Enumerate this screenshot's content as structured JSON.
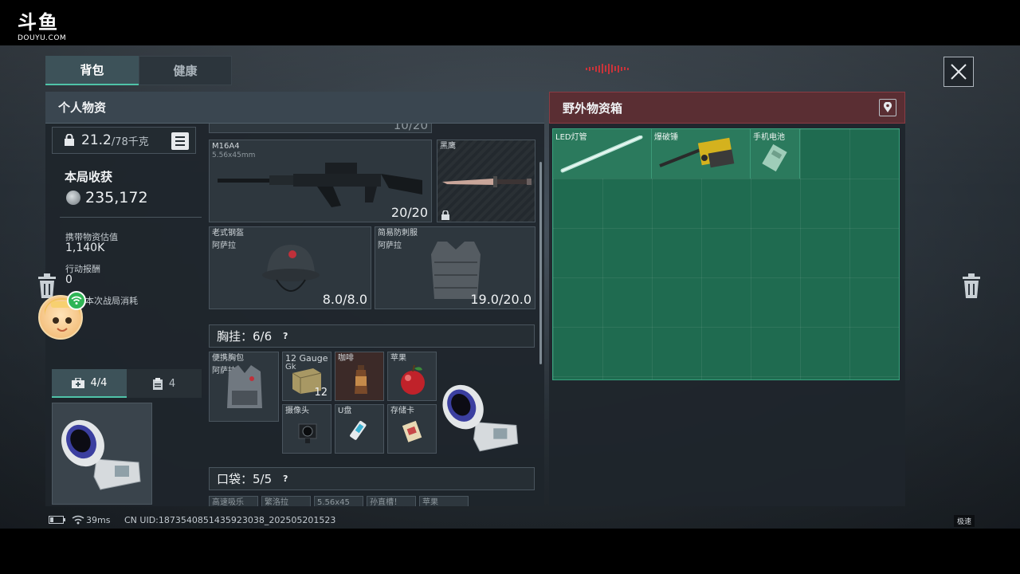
{
  "watermark": {
    "logo": "斗鱼",
    "site": "DOUYU.COM"
  },
  "tabs": [
    {
      "label": "背包",
      "active": true
    },
    {
      "label": "健康",
      "active": false
    }
  ],
  "left_panel": {
    "title": "个人物资",
    "weight": {
      "current": "21.2",
      "max": "/78千克"
    },
    "stats": {
      "title": "本局收获",
      "coins": "235,172",
      "carried_label": "携带物资估值",
      "carried_value": "1,140K",
      "reward_label": "行动报酬",
      "reward_value": "0",
      "cost_label": "本次战局消耗"
    },
    "slot_tabs": [
      {
        "icon": "medkit-icon",
        "label": "4/4"
      },
      {
        "icon": "clipboard-icon",
        "label": "4"
      }
    ],
    "top_count": "10/20",
    "weapon": {
      "name": "M16A4",
      "ammo": "5.56x45mm",
      "count": "20/20"
    },
    "knife": {
      "name": "黑鹰"
    },
    "helmet": {
      "name": "老式钢盔",
      "origin": "阿萨拉",
      "durability": "8.0/8.0"
    },
    "armor": {
      "name": "简易防刺服",
      "origin": "阿萨拉",
      "durability": "19.0/20.0"
    },
    "chest_rig": {
      "title": "胸挂：6/6",
      "help": "?",
      "rig": {
        "name": "便携胸包",
        "origin": "阿萨拉"
      },
      "items": [
        {
          "name": "12 Gauge",
          "sub": "Gk",
          "count": "12"
        },
        {
          "name": "咖啡"
        },
        {
          "name": "苹果"
        },
        {
          "name": "摄像头"
        },
        {
          "name": "U盘"
        },
        {
          "name": "存储卡"
        }
      ]
    },
    "pocket": {
      "title": "口袋：5/5",
      "help": "?",
      "peek_items": [
        "高速吸乐",
        "繁洛拉",
        "5.56x45",
        "孙直槽！",
        "苹果"
      ]
    }
  },
  "right_panel": {
    "title": "野外物资箱",
    "items": [
      {
        "name": "LED灯管"
      },
      {
        "name": "爆破锤"
      },
      {
        "name": "手机电池"
      }
    ]
  },
  "status_bar": {
    "ping": "39ms",
    "uid": "CN UID:1873540851435923038_202505201523"
  },
  "speed_label": "极速",
  "colors": {
    "accent_teal": "#4fc3a8",
    "loot_green": "#1f6b50",
    "crate_red": "#5a2e33"
  }
}
